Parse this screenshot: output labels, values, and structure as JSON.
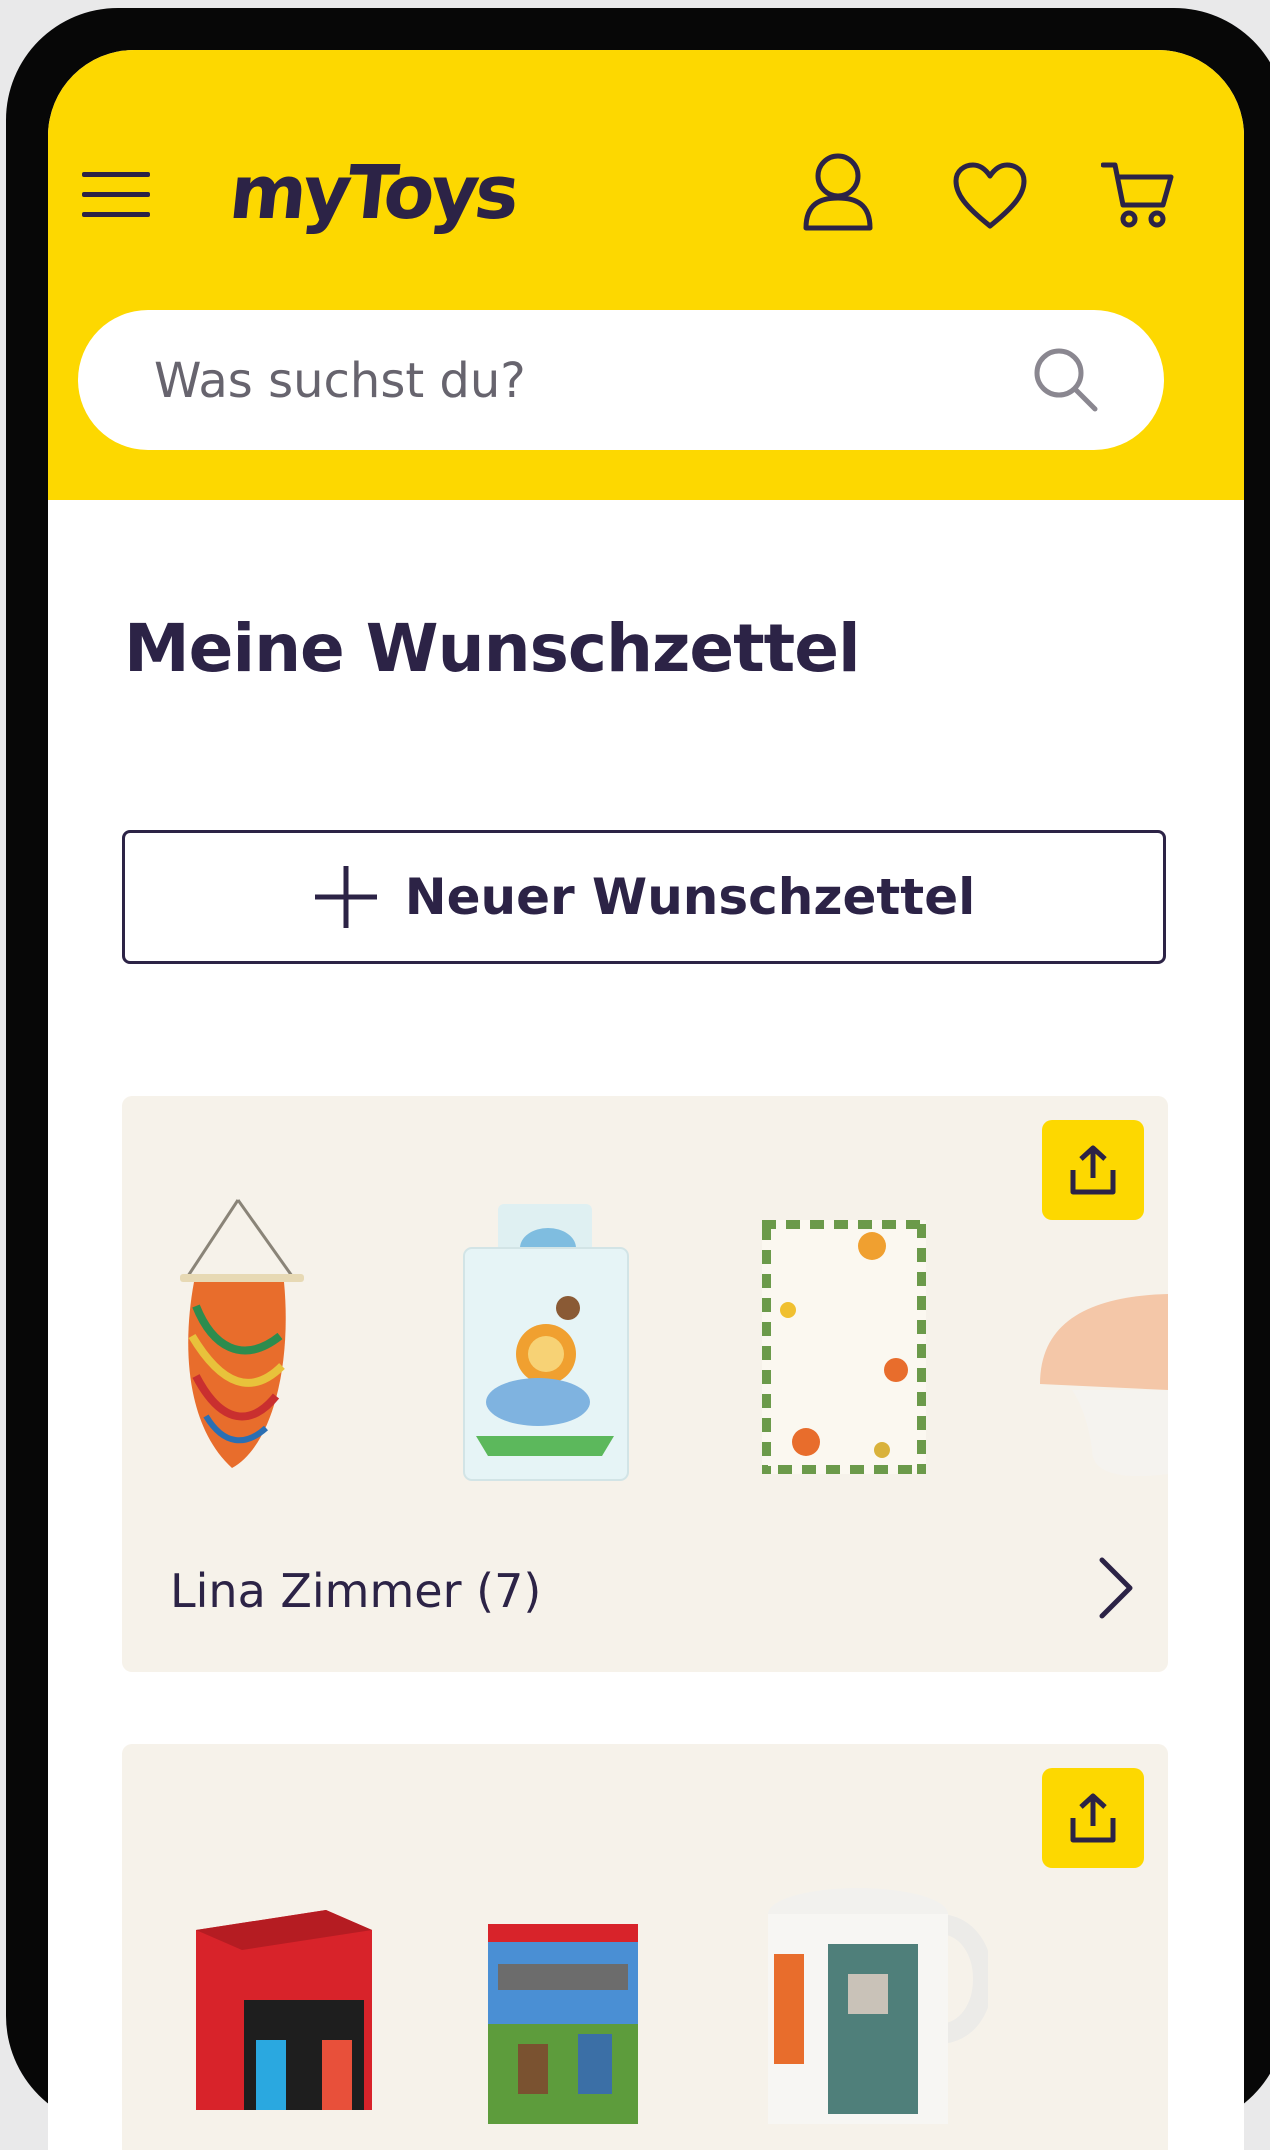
{
  "header": {
    "logo_text": "myToys",
    "search": {
      "placeholder": "Was suchst du?",
      "value": ""
    },
    "icons": [
      "menu-icon",
      "user-icon",
      "heart-icon",
      "cart-icon",
      "search-icon"
    ]
  },
  "page": {
    "title": "Meine Wunschzettel",
    "new_list_button": "Neuer Wunschzettel"
  },
  "wishlists": [
    {
      "label": "Lina Zimmer (7)",
      "items": [
        "hanging-chair",
        "bed-linen",
        "jungle-rug",
        "mushroom-lamp"
      ]
    },
    {
      "label": "",
      "items": [
        "nintendo-switch",
        "minecraft-game",
        "mug"
      ]
    }
  ],
  "colors": {
    "accent": "#fdd800",
    "text": "#2c2346",
    "card_bg": "#f6f2ea",
    "frame": "#070707"
  }
}
